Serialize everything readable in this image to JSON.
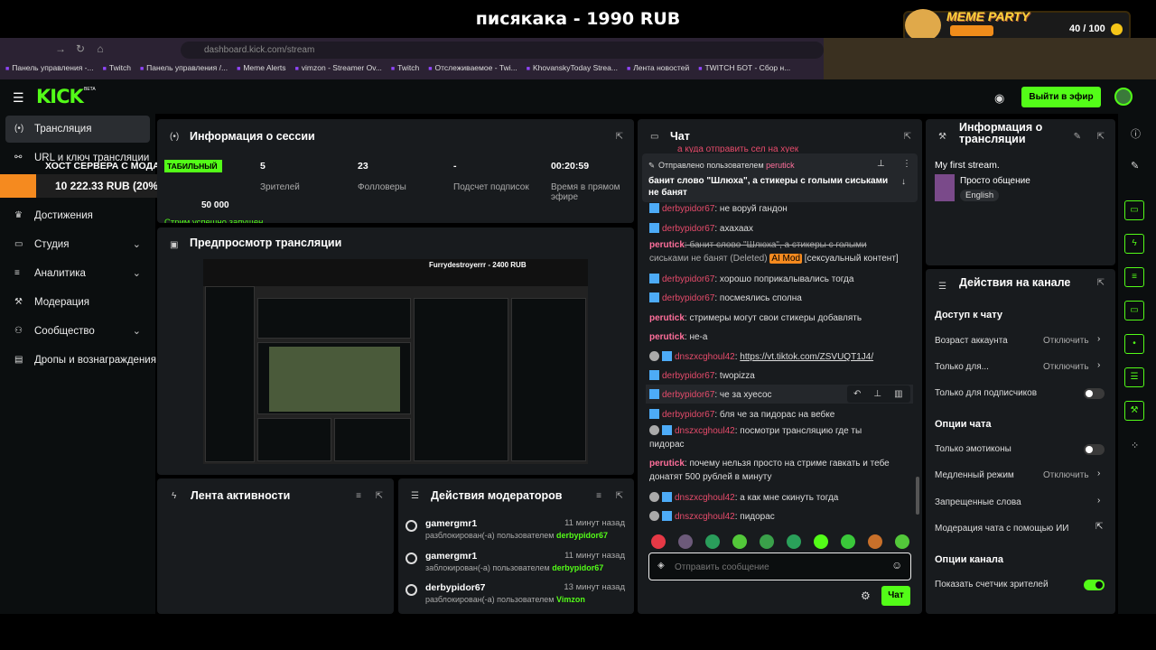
{
  "banner": {
    "title": "писякака - 1990 RUB"
  },
  "meme": {
    "title": "MEME PARTY",
    "count": "40 / 100"
  },
  "browser": {
    "url": "dashboard.kick.com/stream",
    "bookmarks": [
      "Панель управления -...",
      "Twitch",
      "Панель управления /...",
      "Meme Alerts",
      "vimzon - Streamer Ov...",
      "Twitch",
      "Отслеживаемое - Twi...",
      "KhovanskyToday Strea...",
      "Лента новостей",
      "TWITCH БОТ - Сбор н..."
    ]
  },
  "header": {
    "logo": "KICK",
    "beta": "BETA",
    "go_live": "Выйти в эфир"
  },
  "sidebar": {
    "items": [
      {
        "label": "Трансляция"
      },
      {
        "label": "URL и ключ трансляции"
      },
      {
        "label": "Достижения"
      },
      {
        "label": "Студия"
      },
      {
        "label": "Аналитика"
      },
      {
        "label": "Модерация"
      },
      {
        "label": "Сообщество"
      },
      {
        "label": "Дропы и вознаграждения"
      }
    ]
  },
  "donation": {
    "header": "ХОСТ СЕРВЕРА С МОДАМИ",
    "amount": "10 222.33 RUB (20%)",
    "badge": "ТАБИЛЬНЫЙ",
    "goal": "50 000"
  },
  "session": {
    "title": "Информация о сессии",
    "stats": [
      {
        "value": "5",
        "label": "Зрителей"
      },
      {
        "value": "23",
        "label": "Фолловеры"
      },
      {
        "value": "-",
        "label": "Подсчет подписок"
      },
      {
        "value": "00:20:59",
        "label": "Время в прямом эфире"
      }
    ],
    "status": "Стрим успешно запущен"
  },
  "preview": {
    "title": "Предпросмотр трансляции",
    "inner_title": "Furrydestroyerrr - 2400 RUB"
  },
  "activity": {
    "title": "Лента активности"
  },
  "modactions": {
    "title": "Действия модераторов",
    "rows": [
      {
        "name": "gamergmr1",
        "time": "11 минут назад",
        "desc": "разблокирован(-а) пользователем",
        "target": "derbypidor67"
      },
      {
        "name": "gamergmr1",
        "time": "11 минут назад",
        "desc": "заблокирован(-а) пользователем",
        "target": "derbypidor67"
      },
      {
        "name": "derbypidor67",
        "time": "13 минут назад",
        "desc": "разблокирован(-а) пользователем",
        "target": "Vimzon"
      }
    ]
  },
  "chat": {
    "title": "Чат",
    "top_partial": "а куда отправить сел на хуек",
    "pinned_by": "Отправлено пользователем",
    "pinned_user": "perutick",
    "pinned_text": "банит слово \"Шлюха\", а стикеры с голыми сиськами не банят",
    "messages": [
      {
        "user": "derbypidor67",
        "text": ": не воруй гандон"
      },
      {
        "user": "derbypidor67",
        "text": ": ахахаах"
      },
      {
        "user": "perutick",
        "text": ": банит слово \"Шлюха\", а стикеры с голыми",
        "text2": "сиськами не банят (Deleted)",
        "tag": "AI Mod",
        "tag2": "[сексуальный контент]"
      },
      {
        "user": "derbypidor67",
        "text": ": хорошо поприкалывались тогда"
      },
      {
        "user": "derbypidor67",
        "text": ": посмеялись сполна"
      },
      {
        "user": "perutick",
        "text": ": стримеры могут свои стикеры добавлять"
      },
      {
        "user": "perutick",
        "text": ": не-а"
      },
      {
        "user": "dnszxcghoul42",
        "text": ": ",
        "link": "https://vt.tiktok.com/ZSVUQT1J4/"
      },
      {
        "user": "derbypidor67",
        "text": ": twopizza"
      },
      {
        "user": "derbypidor67",
        "text": ": че за хуесос"
      },
      {
        "user": "derbypidor67",
        "text": ": бля че за пидорас на вебке"
      },
      {
        "user": "dnszxcghoul42",
        "text": ": посмотри трансляцию где ты",
        "text2": "пидорас"
      },
      {
        "user": "perutick",
        "text": ": почему нельзя просто на стриме гавкать и тебе",
        "text2": "донатят 500 рублей в минуту"
      },
      {
        "user": "dnszxcghoul42",
        "text": ": а как мне скинуть тогда"
      },
      {
        "user": "dnszxcghoul42",
        "text": ": пидорас"
      }
    ],
    "input_placeholder": "Отправить сообщение",
    "send": "Чат"
  },
  "streaminfo": {
    "title": "Информация о трансляции",
    "stream_title": "My first stream.",
    "category": "Просто общение",
    "language": "English"
  },
  "channel": {
    "title": "Действия на канале",
    "access_header": "Доступ к чату",
    "account_age": "Возраст аккаунта",
    "account_age_val": "Отключить",
    "only_for": "Только для...",
    "only_for_val": "Отключить",
    "subs_only": "Только для подписчиков",
    "chat_options": "Опции чата",
    "emotes_only": "Только эмотиконы",
    "slow_mode": "Медленный режим",
    "slow_mode_val": "Отключить",
    "banned_words": "Запрещенные слова",
    "ai_mod": "Модерация чата с помощью ИИ",
    "channel_options": "Опции канала",
    "show_viewers": "Показать счетчик зрителей"
  }
}
